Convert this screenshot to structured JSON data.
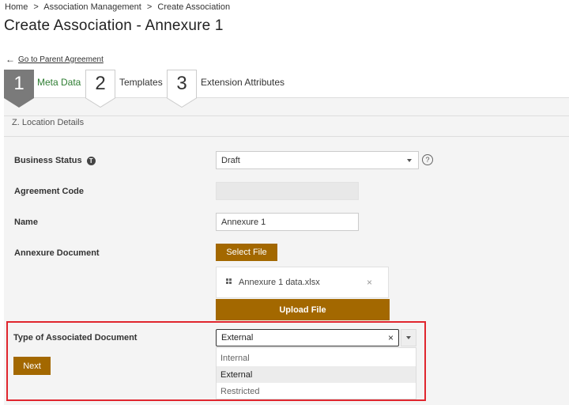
{
  "breadcrumb": {
    "items": [
      "Home",
      ">",
      "Association Management",
      ">",
      "Create Association"
    ]
  },
  "page_title": "Create Association - Annexure 1",
  "back_link": {
    "label": "Go to Parent Agreement",
    "icon": "arrow-left-icon"
  },
  "steps": [
    {
      "number": "1",
      "label": "Meta Data",
      "active": true
    },
    {
      "number": "2",
      "label": "Templates",
      "active": false
    },
    {
      "number": "3",
      "label": "Extension Attributes",
      "active": false
    }
  ],
  "section": {
    "title": "Z. Location Details"
  },
  "form": {
    "business_status": {
      "label": "Business Status",
      "info_icon": "T",
      "value": "Draft",
      "help": "?"
    },
    "agreement_code": {
      "label": "Agreement Code",
      "value": ""
    },
    "name": {
      "label": "Name",
      "value": "Annexure 1"
    },
    "annexure_document": {
      "label": "Annexure Document",
      "select_label": "Select File",
      "file_name": "Annexure 1 data.xlsx",
      "remove": "×",
      "upload_label": "Upload File"
    },
    "type_of_doc": {
      "label": "Type of Associated Document",
      "value": "External",
      "clear": "×",
      "options": [
        "Internal",
        "External",
        "Restricted"
      ],
      "selected_index": 1
    }
  },
  "next_label": "Next",
  "colors": {
    "accent": "#a36800",
    "active_step": "#7a7a7a",
    "step_label_active": "#2e7d32",
    "highlight": "#e0262e"
  }
}
